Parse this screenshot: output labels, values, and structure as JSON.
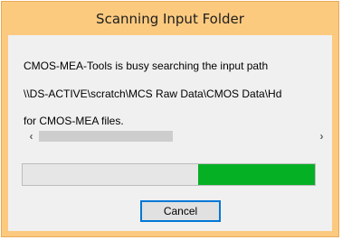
{
  "window": {
    "title": "Scanning Input Folder"
  },
  "message": {
    "line1": "CMOS-MEA-Tools is busy searching the input path",
    "line2": "\\\\DS-ACTIVE\\scratch\\MCS Raw Data\\CMOS Data\\Hd",
    "line3": "for CMOS-MEA files."
  },
  "scrollbar": {
    "left_icon": "chevron-left-icon",
    "right_icon": "chevron-right-icon"
  },
  "progress": {
    "mode": "marquee",
    "highlight_start_fraction": 0.6,
    "highlight_end_fraction": 1.0,
    "fill_color": "#06b025"
  },
  "buttons": {
    "cancel_label": "Cancel"
  },
  "colors": {
    "frame": "#fcca7f",
    "client": "#f0f0f0",
    "focus_border": "#0078d7"
  }
}
